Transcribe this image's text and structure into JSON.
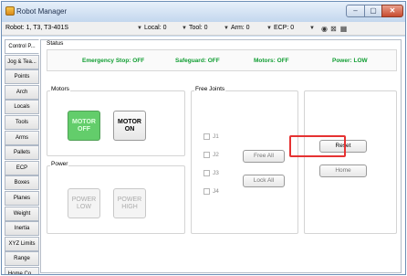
{
  "window": {
    "title": "Robot Manager",
    "controls": {
      "minimize": "–",
      "maximize": "▢",
      "close": "✕"
    }
  },
  "toolbar": {
    "robot": "Robot: 1, T3, T3-401S",
    "local": "Local: 0",
    "tool": "Tool: 0",
    "arm": "Arm: 0",
    "ecp": "ECP: 0"
  },
  "sidebar": {
    "tabs": [
      "Control P...",
      "Jog & Tea...",
      "Points",
      "Arch",
      "Locals",
      "Tools",
      "Arms",
      "Pallets",
      "ECP",
      "Boxes",
      "Planes",
      "Weight",
      "Inertia",
      "XYZ Limits",
      "Range",
      "Home Co..."
    ]
  },
  "status": {
    "label": "Status",
    "emergency": "Emergency Stop: OFF",
    "safeguard": "Safeguard: OFF",
    "motors": "Motors: OFF",
    "power": "Power: LOW",
    "color": "#109d32"
  },
  "motors": {
    "label": "Motors",
    "off": [
      "MOTOR",
      "OFF"
    ],
    "on": [
      "MOTOR",
      "ON"
    ],
    "active_color": "#63cd6b"
  },
  "power": {
    "label": "Power",
    "low": [
      "POWER",
      "LOW"
    ],
    "high": [
      "POWER",
      "HIGH"
    ]
  },
  "free_joints": {
    "label": "Free Joints",
    "joints": [
      "J1",
      "J2",
      "J3",
      "J4"
    ],
    "free_all": "Free All",
    "lock_all": "Lock All"
  },
  "actions": {
    "reset": "Reset",
    "home": "Home",
    "highlight_color": "#e53232"
  }
}
